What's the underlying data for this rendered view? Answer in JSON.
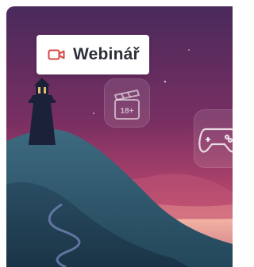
{
  "badge": {
    "label": "Webinář",
    "icon": "video-camera-icon",
    "icon_color": "#d64545"
  },
  "illustration": {
    "sky_top": "#4a2a5c",
    "sky_mid": "#8a3560",
    "sky_bottom": "#e06a7a",
    "hill_color": "#2f5a72",
    "lighthouse_color": "#1b2138",
    "icons": [
      "clapperboard-18-icon",
      "gamepad-icon"
    ],
    "rating_text": "18+"
  }
}
